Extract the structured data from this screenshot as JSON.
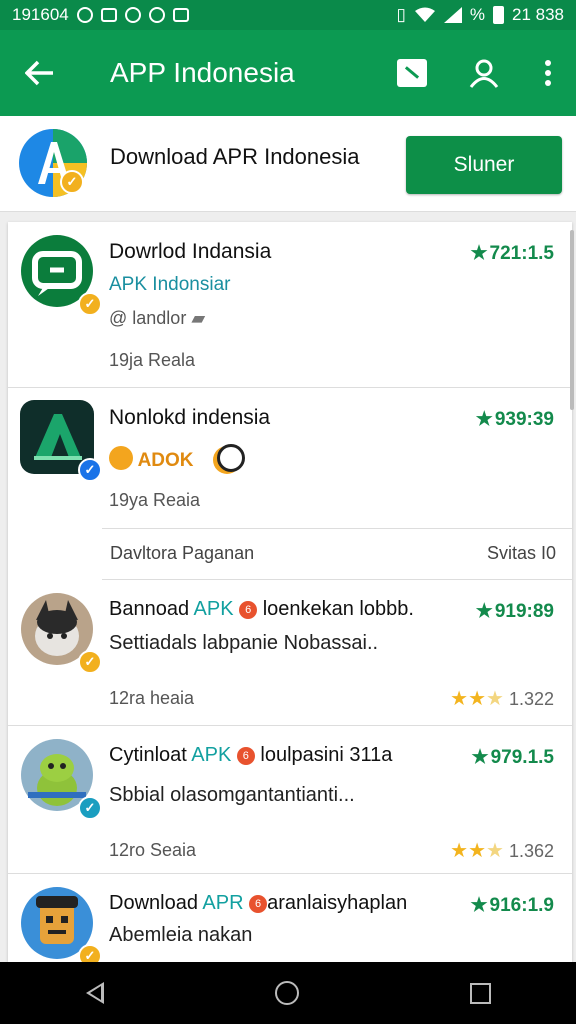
{
  "status_bar": {
    "time_text": "191604",
    "right_text": "21 838",
    "percent": "%"
  },
  "app_bar": {
    "title": "APP Indonesia"
  },
  "header": {
    "title": "Download APR Indonesia",
    "button_label": "Sluner"
  },
  "items": [
    {
      "name": "Dowrlod Indansia",
      "sub": "APK Indonsiar",
      "tag": "@ landlor",
      "meta": "19ja Reala",
      "rating": "721:1.5"
    },
    {
      "name": "Nonlokd indensia",
      "sub": "ADOK",
      "meta": "19ya Reaia",
      "rating": "939:39"
    },
    {
      "section": true,
      "left": "Davltora Paganan",
      "right": "Svitas I0"
    },
    {
      "name_a": "Bannoad",
      "apk": "APK",
      "name_b": "loenkekan lobbb.",
      "desc": "Settiadals labpanie Nobassai..",
      "meta": "12ra heaia",
      "rating": "919:89",
      "star_value": "1.322"
    },
    {
      "name_a": "Cytinloat",
      "apk": "APK",
      "name_b": "loulpasini 311a",
      "desc": "Sbbial olasomgantantianti...",
      "meta": "12ro Seaia",
      "rating": "979.1.5",
      "star_value": "1.362"
    },
    {
      "name_a": "Download",
      "apk": "APR",
      "name_b": "aranlaisyhaplan",
      "desc": "Abemleia nakan",
      "rating": "916:1.9"
    }
  ]
}
